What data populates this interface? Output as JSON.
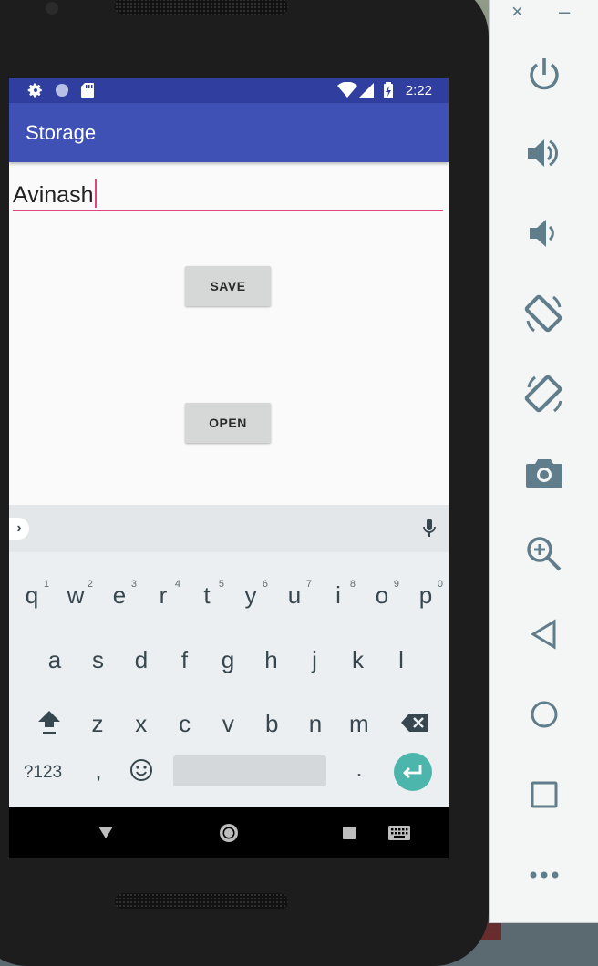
{
  "status_bar": {
    "time": "2:22",
    "icons": [
      "settings-icon",
      "circle-icon",
      "sd-card-icon",
      "wifi-icon",
      "signal-icon",
      "battery-icon"
    ]
  },
  "app": {
    "title": "Storage",
    "input_value": "Avinash",
    "save_label": "SAVE",
    "open_label": "OPEN",
    "accent_color": "#e0457b",
    "primary_color": "#3f51b5",
    "primary_dark_color": "#303f9f"
  },
  "keyboard": {
    "row1": [
      {
        "key": "q",
        "hint": "1"
      },
      {
        "key": "w",
        "hint": "2"
      },
      {
        "key": "e",
        "hint": "3"
      },
      {
        "key": "r",
        "hint": "4"
      },
      {
        "key": "t",
        "hint": "5"
      },
      {
        "key": "y",
        "hint": "6"
      },
      {
        "key": "u",
        "hint": "7"
      },
      {
        "key": "i",
        "hint": "8"
      },
      {
        "key": "o",
        "hint": "9"
      },
      {
        "key": "p",
        "hint": "0"
      }
    ],
    "row2": [
      "a",
      "s",
      "d",
      "f",
      "g",
      "h",
      "j",
      "k",
      "l"
    ],
    "row3": [
      "z",
      "x",
      "c",
      "v",
      "b",
      "n",
      "m"
    ],
    "symbols_label": "?123",
    "comma": ",",
    "period": ".",
    "icons": [
      "expand-icon",
      "mic-icon",
      "shift-icon",
      "backspace-icon",
      "emoji-icon",
      "enter-icon"
    ]
  },
  "nav_bar": {
    "icons": [
      "back-triangle-icon",
      "home-circle-icon",
      "recents-square-icon",
      "keyboard-switch-icon"
    ]
  },
  "emulator_toolbar": {
    "icons": [
      "close-icon",
      "minimize-icon",
      "power-icon",
      "volume-up-icon",
      "volume-down-icon",
      "rotate-left-icon",
      "rotate-right-icon",
      "camera-icon",
      "zoom-icon",
      "back-icon",
      "home-icon",
      "overview-icon",
      "more-icon"
    ]
  }
}
